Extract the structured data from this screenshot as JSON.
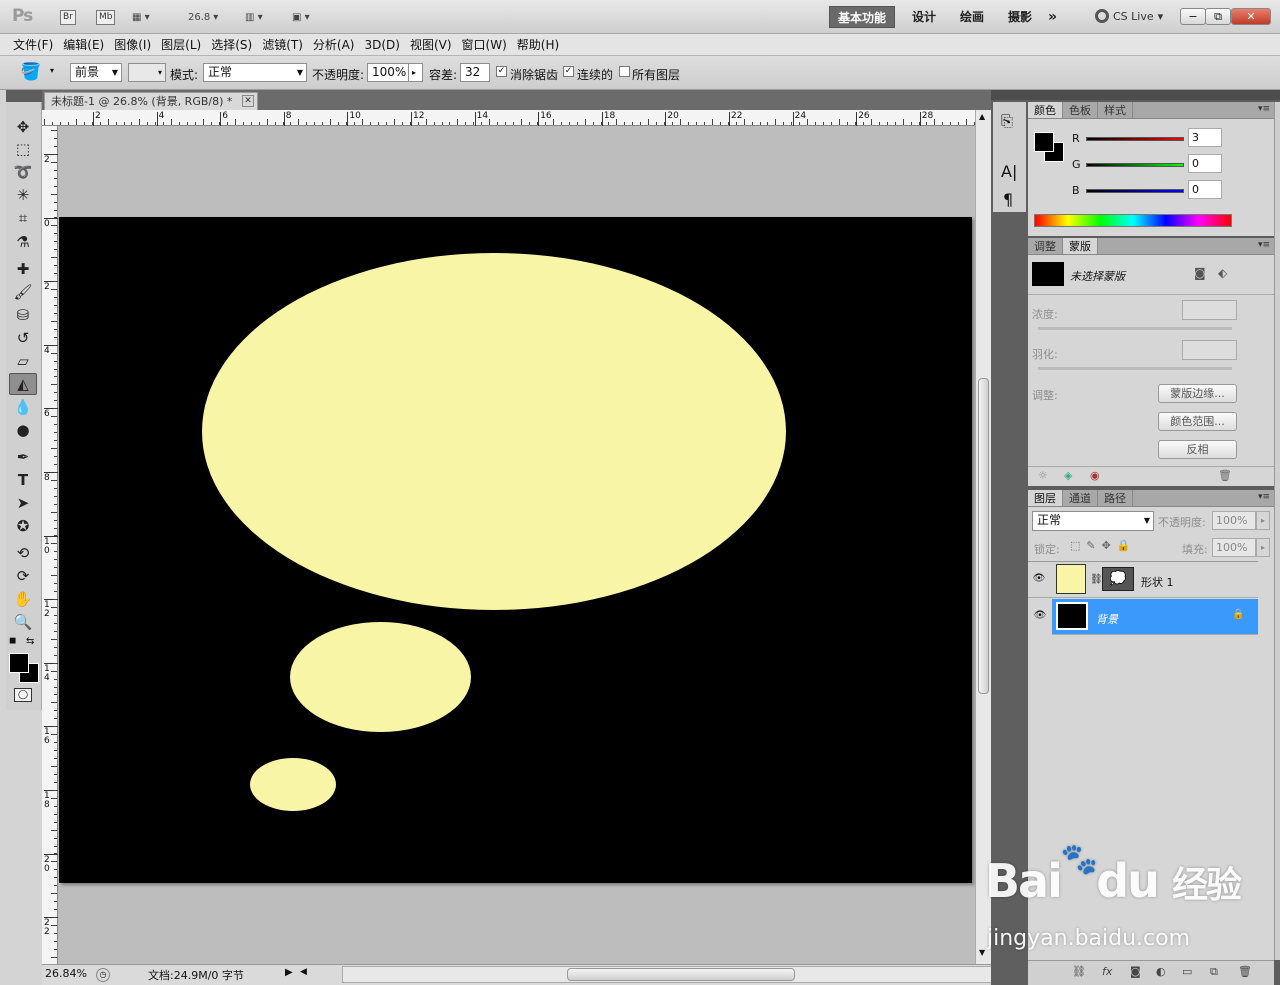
{
  "app": {
    "logo": "Ps",
    "br": "Br",
    "mb": "Mb",
    "zoom_dropdown": "26.8"
  },
  "workspaces": [
    "基本功能",
    "设计",
    "绘画",
    "摄影"
  ],
  "more_workspaces": "»",
  "cs_live": "CS Live",
  "window_buttons": {
    "minimize": "−",
    "restore": "⧉",
    "close": "✕"
  },
  "menu": [
    "文件(F)",
    "编辑(E)",
    "图像(I)",
    "图层(L)",
    "选择(S)",
    "滤镜(T)",
    "分析(A)",
    "3D(D)",
    "视图(V)",
    "窗口(W)",
    "帮助(H)"
  ],
  "options": {
    "fill_source": "前景",
    "mode_label": "模式:",
    "mode_value": "正常",
    "opacity_label": "不透明度:",
    "opacity_value": "100%",
    "tolerance_label": "容差:",
    "tolerance_value": "32",
    "antialias_label": "消除锯齿",
    "antialias_checked": true,
    "contiguous_label": "连续的",
    "contiguous_checked": true,
    "all_layers_label": "所有图层",
    "all_layers_checked": false
  },
  "document": {
    "tab_title": "未标题-1 @ 26.8% (背景, RGB/8) *",
    "hruler_labels": [
      "2",
      "4",
      "6",
      "8",
      "10",
      "12",
      "14",
      "16",
      "18",
      "20",
      "22",
      "24",
      "26",
      "28"
    ],
    "vruler_labels": [
      "2",
      "0",
      "2",
      "4",
      "6",
      "8",
      "1\n0",
      "1\n2",
      "1\n4",
      "1\n6",
      "1\n8",
      "2\n0",
      "2\n2"
    ],
    "bubble_color": "#f8f6a6",
    "background_color": "#000000"
  },
  "status": {
    "zoom": "26.84%",
    "doc_info": "文档:24.9M/0 字节"
  },
  "color_panel": {
    "tabs": [
      "颜色",
      "色板",
      "样式"
    ],
    "channels": [
      {
        "name": "R",
        "value": "3"
      },
      {
        "name": "G",
        "value": "0"
      },
      {
        "name": "B",
        "value": "0"
      }
    ]
  },
  "masks_panel": {
    "tabs": [
      "调整",
      "蒙版"
    ],
    "no_mask": "未选择蒙版",
    "density": "浓度:",
    "feather": "羽化:",
    "refine": "调整:",
    "mask_edge": "蒙版边缘...",
    "color_range": "颜色范围...",
    "invert": "反相"
  },
  "layers_panel": {
    "tabs": [
      "图层",
      "通道",
      "路径"
    ],
    "blend": "正常",
    "opacity_label": "不透明度:",
    "opacity_value": "100%",
    "lock_label": "锁定:",
    "fill_label": "填充:",
    "fill_value": "100%",
    "layers": [
      {
        "name": "形状 1",
        "selected": false
      },
      {
        "name": "背景",
        "selected": true
      }
    ]
  },
  "watermark": {
    "brand": "Bai",
    "brand2": "du",
    "suffix": "经验",
    "url": "jingyan.baidu.com"
  }
}
